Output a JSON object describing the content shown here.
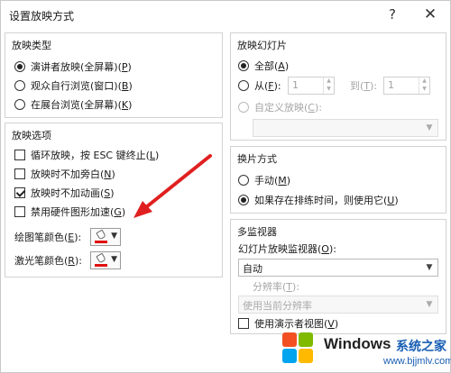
{
  "window": {
    "title": "设置放映方式",
    "help": "?",
    "close": "✕"
  },
  "show_type": {
    "title": "放映类型",
    "options": [
      {
        "label": "演讲者放映(全屏幕)",
        "key": "P",
        "selected": true
      },
      {
        "label": "观众自行浏览(窗口)",
        "key": "B",
        "selected": false
      },
      {
        "label": "在展台浏览(全屏幕)",
        "key": "K",
        "selected": false
      }
    ]
  },
  "show_options": {
    "title": "放映选项",
    "checkboxes": [
      {
        "label": "循环放映，按 ESC 键终止",
        "key": "L",
        "checked": false
      },
      {
        "label": "放映时不加旁白",
        "key": "N",
        "checked": false
      },
      {
        "label": "放映时不加动画",
        "key": "S",
        "checked": true
      },
      {
        "label": "禁用硬件图形加速",
        "key": "G",
        "checked": false
      }
    ],
    "pen_color": {
      "label": "绘图笔颜色",
      "key": "E",
      "color": "#e01010"
    },
    "laser_color": {
      "label": "激光笔颜色",
      "key": "R",
      "color": "#e01010"
    }
  },
  "slides": {
    "title": "放映幻灯片",
    "all": {
      "label": "全部",
      "key": "A",
      "selected": true
    },
    "from": {
      "label": "从",
      "key": "F",
      "value": "1",
      "selected": false
    },
    "to": {
      "label": "到",
      "key": "T",
      "value": "1"
    },
    "custom": {
      "label": "自定义放映",
      "key": "C",
      "selected": false,
      "value": ""
    }
  },
  "advance": {
    "title": "换片方式",
    "options": [
      {
        "label": "手动",
        "key": "M",
        "selected": false
      },
      {
        "label": "如果存在排练时间，则使用它",
        "key": "U",
        "selected": true
      }
    ]
  },
  "monitors": {
    "title": "多监视器",
    "monitor_label": "幻灯片放映监视器",
    "monitor_key": "O",
    "monitor_value": "自动",
    "resolution_label": "分辨率",
    "resolution_key": "T",
    "resolution_value": "使用当前分辨率",
    "presenter_view": {
      "label": "使用演示者视图",
      "key": "V",
      "checked": false
    }
  },
  "watermark": {
    "brand": "Windows",
    "cn": "系统之家",
    "url": "www.bjjmlv.com"
  },
  "colors": {
    "arrow": "#e02020",
    "logo": [
      "#f25022",
      "#7fba00",
      "#00a4ef",
      "#ffb900"
    ]
  }
}
